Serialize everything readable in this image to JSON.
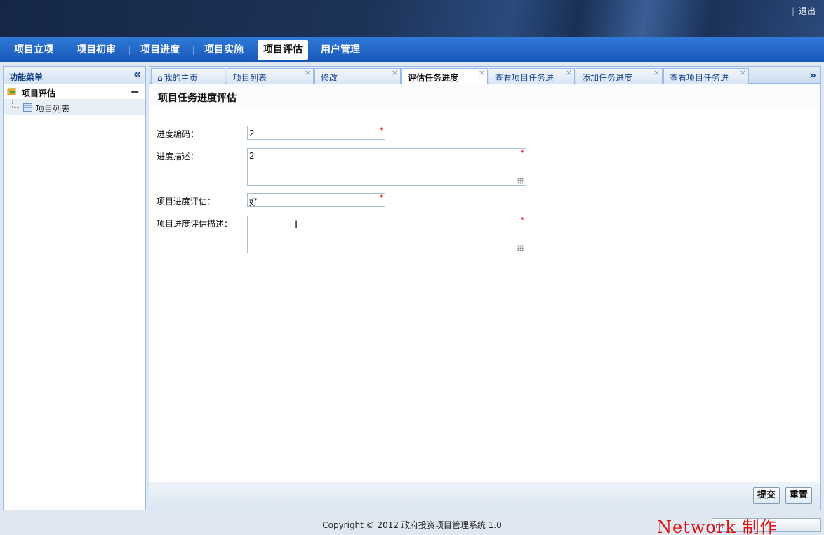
{
  "header": {
    "logout_label": "退出",
    "logout_separator": "|"
  },
  "nav": {
    "items": [
      {
        "label": "项目立项"
      },
      {
        "label": "项目初审"
      },
      {
        "label": "项目进度"
      },
      {
        "label": "项目实施"
      },
      {
        "label": "项目评估",
        "active": true
      },
      {
        "label": "用户管理"
      }
    ]
  },
  "sidebar": {
    "title": "功能菜单",
    "collapse_icon": "double-chevron-left-icon",
    "group": {
      "label": "项目评估",
      "toggle": "−"
    },
    "items": [
      {
        "label": "项目列表"
      }
    ]
  },
  "tabs": {
    "items": [
      {
        "label": "我的主页",
        "closable": false,
        "icon": "home-icon"
      },
      {
        "label": "项目列表",
        "closable": true
      },
      {
        "label": "修改",
        "closable": true
      },
      {
        "label": "评估任务进度",
        "closable": true,
        "active": true
      },
      {
        "label": "查看项目任务进",
        "closable": true
      },
      {
        "label": "添加任务进度",
        "closable": true
      },
      {
        "label": "查看项目任务进",
        "closable": true
      }
    ],
    "close_glyph": "×",
    "more_icon": "double-chevron-down-icon"
  },
  "form": {
    "title": "项目任务进度评估",
    "fields": [
      {
        "label": "进度编码：",
        "value": "2",
        "required": "*"
      },
      {
        "label": "进度描述：",
        "value": "2",
        "required": "*"
      },
      {
        "label": "项目进度评估：",
        "value": "好",
        "required": "*"
      },
      {
        "label": "项目进度评估描述：",
        "value": "",
        "required": "*"
      }
    ],
    "submit_label": "提交",
    "reset_label": "重置"
  },
  "footer": {
    "copyright": "Copyright © 2012 政府投资项目管理系统 1.0"
  },
  "overlay": {
    "watermark": "Network 制作",
    "ime_label": "中"
  },
  "colors": {
    "nav_blue": "#1f64c6",
    "panel_border": "#99bbe8",
    "banner_dark": "#162746",
    "required_red": "#ee0000"
  }
}
